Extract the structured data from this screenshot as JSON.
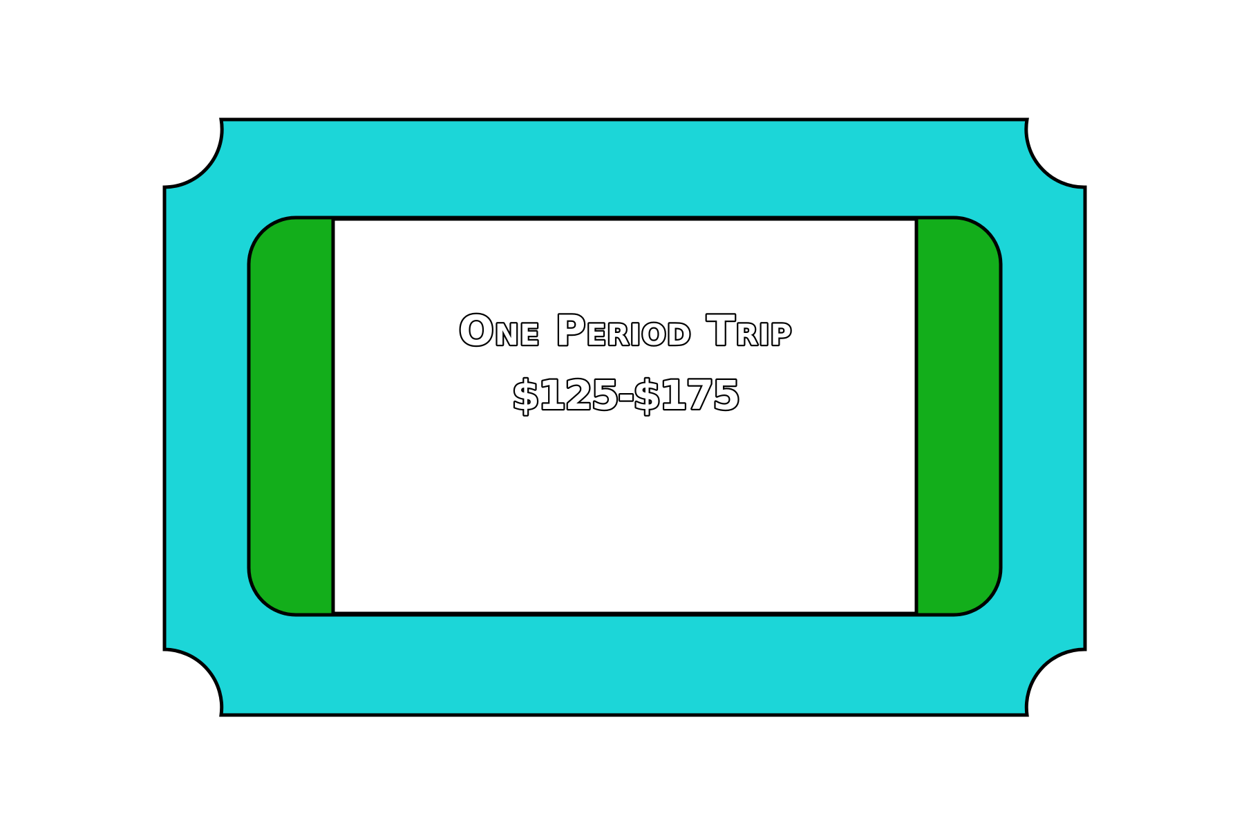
{
  "ticket": {
    "title": "One Period Trip",
    "price": "$125-$175"
  },
  "colors": {
    "outer": "#1cd6d8",
    "side_panels": "#13ae1b",
    "center": "#ffffff",
    "outline": "#000000",
    "background": "#ffffff"
  }
}
